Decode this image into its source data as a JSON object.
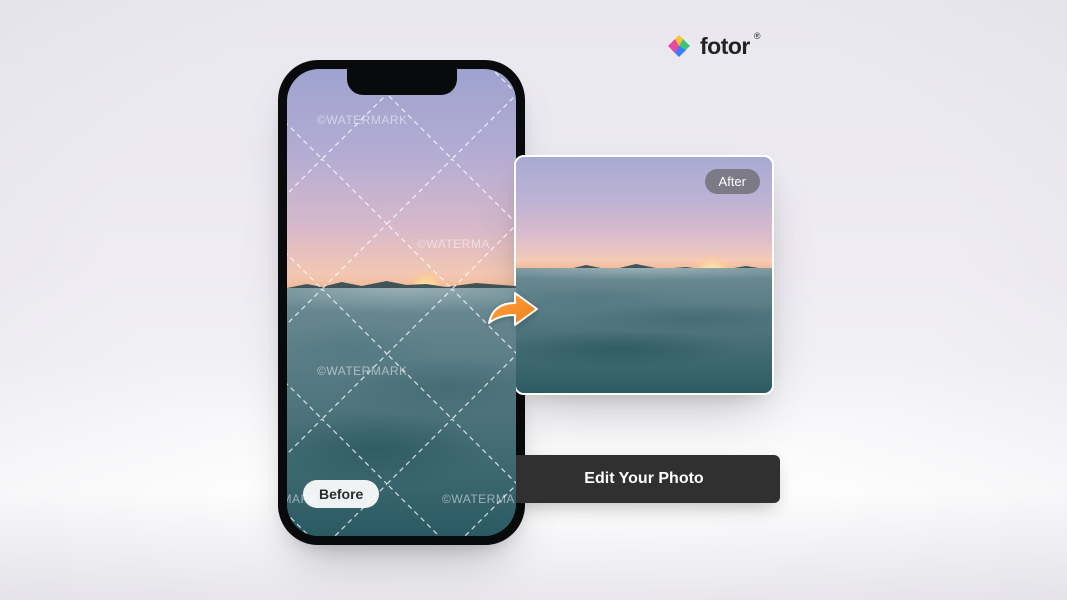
{
  "brand": {
    "name": "fotor",
    "registered": "®"
  },
  "labels": {
    "before": "Before",
    "after": "After"
  },
  "watermark": {
    "text": "©WATERMARK",
    "text_partial_left": "©WATERMA",
    "text_partial_right": "WATERMARK"
  },
  "cta": {
    "edit": "Edit Your Photo"
  },
  "colors": {
    "button_bg": "#303030",
    "button_fg": "#ffffff",
    "after_badge_bg": "#6e6d73",
    "before_badge_bg": "#ffffff"
  }
}
